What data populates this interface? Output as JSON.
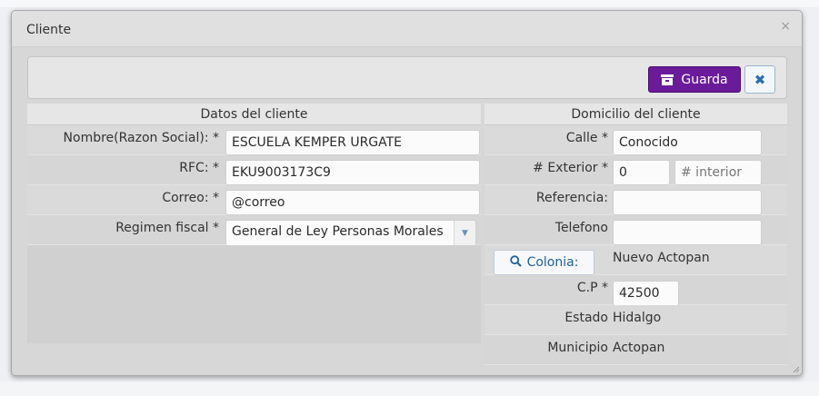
{
  "dialog": {
    "title": "Cliente",
    "close_glyph": "×"
  },
  "toolbar": {
    "save_label": "Guarda",
    "cancel_glyph": "✖"
  },
  "client": {
    "section_title": "Datos del cliente",
    "name_label": "Nombre(Razon Social): *",
    "name_value": "ESCUELA KEMPER URGATE",
    "rfc_label": "RFC: *",
    "rfc_value": "EKU9003173C9",
    "email_label": "Correo: *",
    "email_value": "@correo",
    "regime_label": "Regimen fiscal *",
    "regime_value": "General de Ley Personas Morales"
  },
  "address": {
    "section_title": "Domicilio del cliente",
    "street_label": "Calle *",
    "street_value": "Conocido",
    "ext_label": "# Exterior *",
    "ext_value": "0",
    "int_placeholder": "# interior",
    "reference_label": "Referencia:",
    "reference_value": "",
    "phone_label": "Telefono",
    "phone_value": "",
    "colonia_button": "Colonia:",
    "colonia_value": "Nuevo Actopan",
    "cp_label": "C.P *",
    "cp_value": "42500",
    "state_label": "Estado",
    "state_value": "Hidalgo",
    "municipality_label": "Municipio",
    "municipality_value": "Actopan"
  },
  "colors": {
    "accent": "#6a1b9a",
    "link": "#1f5e9c"
  },
  "icons": {
    "save": "save-icon",
    "cancel": "close-icon",
    "search": "search-icon",
    "select_arrow": "chevron-down-icon"
  }
}
